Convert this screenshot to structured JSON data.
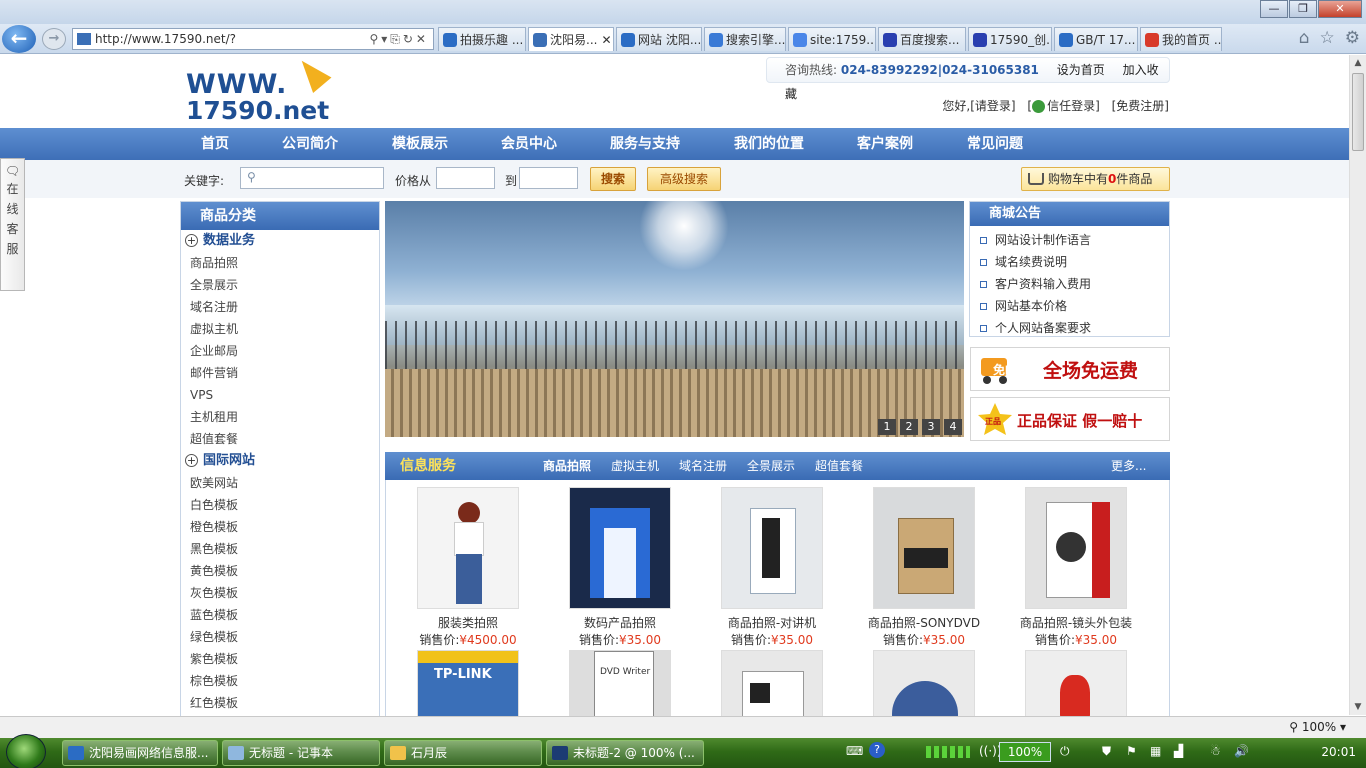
{
  "browser": {
    "address": "http://www.17590.net/?",
    "tabs": [
      {
        "label": "拍摄乐趣 ...",
        "icon": "ie-icon",
        "color": "#2b6cc4",
        "active": false
      },
      {
        "label": "沈阳易...",
        "icon": "cart-favicon",
        "color": "#3b6fb6",
        "active": true
      },
      {
        "label": "网站 沈阳...",
        "icon": "ie-icon",
        "color": "#2b6cc4",
        "active": false
      },
      {
        "label": "搜索引擎...",
        "icon": "a-icon",
        "color": "#3a7ad6",
        "active": false
      },
      {
        "label": "site:1759...",
        "icon": "g-icon",
        "color": "#4a86e8",
        "active": false
      },
      {
        "label": "百度搜索...",
        "icon": "baidu-paw-icon",
        "color": "#2a3fb0",
        "active": false
      },
      {
        "label": "17590_创...",
        "icon": "baidu-paw-icon",
        "color": "#2a3fb0",
        "active": false
      },
      {
        "label": "GB/T 17...",
        "icon": "ie-icon",
        "color": "#2b6cc4",
        "active": false
      },
      {
        "label": "我的首页 ...",
        "icon": "weibo-icon",
        "color": "#d83a2a",
        "active": false
      }
    ],
    "zoom": "100%"
  },
  "header": {
    "logo_line1": "WWW.",
    "logo_line2": "17590.net",
    "hotline_label": "咨询热线:",
    "hotline_numbers": "024-83992292|024-31065381",
    "set_home": "设为首页",
    "add_fav": "加入收藏",
    "greeting": "您好,",
    "login": "[请登录]",
    "trust_login_pre": "[",
    "trust_login": "信任登录]",
    "register": "[免费注册]"
  },
  "nav": [
    "首页",
    "公司简介",
    "模板展示",
    "会员中心",
    "服务与支持",
    "我们的位置",
    "客户案例",
    "常见问题"
  ],
  "search": {
    "keyword_label": "关键字:",
    "price_from": "价格从",
    "price_to": "到",
    "search_btn": "搜索",
    "adv_btn": "高级搜索",
    "cart_pre": "购物车中有",
    "cart_count": "0",
    "cart_post": "件商品"
  },
  "side_service": [
    "在",
    "线",
    "客",
    "服"
  ],
  "sidebar": {
    "title": "商品分类",
    "groups": [
      {
        "name": "数据业务",
        "items": [
          "商品拍照",
          "全景展示",
          "域名注册",
          "虚拟主机",
          "企业邮局",
          "邮件营销",
          "VPS",
          "主机租用",
          "超值套餐"
        ]
      },
      {
        "name": "国际网站",
        "items": [
          "欧美网站",
          "白色模板",
          "橙色模板",
          "黑色模板",
          "黄色模板",
          "灰色模板",
          "蓝色模板",
          "绿色模板",
          "紫色模板",
          "棕色模板",
          "红色模板"
        ]
      }
    ]
  },
  "banner": {
    "pages": [
      "1",
      "2",
      "3",
      "4"
    ]
  },
  "notice": {
    "title": "商城公告",
    "items": [
      "网站设计制作语言",
      "域名续费说明",
      "客户资料输入费用",
      "网站基本价格",
      "个人网站备案要求"
    ]
  },
  "promos": {
    "free_ship_badge": "免邮",
    "free_ship": "全场免运费",
    "genuine_badge": "正品",
    "genuine": "正品保证 假一赔十"
  },
  "info": {
    "title": "信息服务",
    "tabs": [
      "商品拍照",
      "虚拟主机",
      "域名注册",
      "全景展示",
      "超值套餐"
    ],
    "more": "更多..."
  },
  "products": [
    {
      "name": "服装类拍照",
      "price_label": "销售价:",
      "price": "¥4500.00",
      "img": "model-photo"
    },
    {
      "name": "数码产品拍照",
      "price_label": "销售价:",
      "price": "¥35.00",
      "img": "studio-photo"
    },
    {
      "name": "商品拍照-对讲机",
      "price_label": "销售价:",
      "price": "¥35.00",
      "img": "walkie-photo"
    },
    {
      "name": "商品拍照-SONYDVD",
      "price_label": "销售价:",
      "price": "¥35.00",
      "img": "box-photo"
    },
    {
      "name": "商品拍照-镜头外包装",
      "price_label": "销售价:",
      "price": "¥35.00",
      "img": "lens-box-photo"
    }
  ],
  "products_row2": [
    {
      "img": "tplink-box",
      "label": "TP-LINK"
    },
    {
      "img": "dvd-writer-box",
      "label": "DVD Writer"
    },
    {
      "img": "device-box",
      "label": ""
    },
    {
      "img": "gauge",
      "label": ""
    },
    {
      "img": "ornament",
      "label": ""
    }
  ],
  "taskbar": {
    "items": [
      {
        "label": "沈阳易画网络信息服..."
      },
      {
        "label": "无标题 - 记事本"
      },
      {
        "label": "石月辰"
      },
      {
        "label": "未标题-2 @ 100% (..."
      }
    ],
    "battery": "100%",
    "clock": "20:01"
  }
}
